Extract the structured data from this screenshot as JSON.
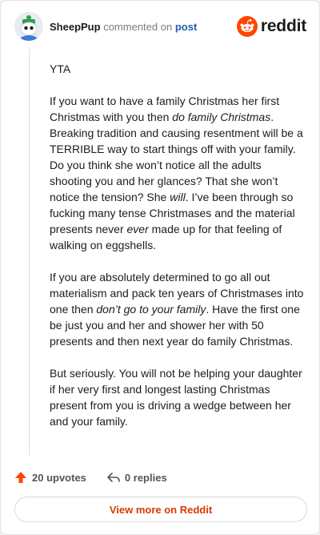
{
  "comment": {
    "username": "SheepPup",
    "commented_on_text": "commented on",
    "post_link_text": "post",
    "body": {
      "p1": "YTA",
      "p2": [
        {
          "t": "If you want to have a family Christmas her first Christmas with you then ",
          "i": false
        },
        {
          "t": "do family Christmas",
          "i": true
        },
        {
          "t": ". Breaking tradition and causing resentment will be a TERRIBLE way to start things off with your family. Do you think she won’t notice all the adults shooting you and her glances? That she won’t notice the tension? She ",
          "i": false
        },
        {
          "t": "will",
          "i": true
        },
        {
          "t": ". I’ve been through so fucking many tense Christmases and the material presents never ",
          "i": false
        },
        {
          "t": "ever",
          "i": true
        },
        {
          "t": " made up for that feeling of walking on eggshells.",
          "i": false
        }
      ],
      "p3": [
        {
          "t": "If you are absolutely determined to go all out materialism and pack ten years of Christmases into one then ",
          "i": false
        },
        {
          "t": "don’t go to your family",
          "i": true
        },
        {
          "t": ". Have the first one be just you and her and shower her with 50 presents and then next year do family Christmas.",
          "i": false
        }
      ],
      "p4": "But seriously. You will not be helping your daughter if her very first and longest lasting Christmas present from you is driving a wedge between her and your family."
    }
  },
  "branding": {
    "logo_text": "reddit",
    "accent_color": "#ff4500"
  },
  "actions": {
    "upvotes_label": "20 upvotes",
    "replies_label": "0 replies"
  },
  "view_more_label": "View more on Reddit",
  "icons": {
    "avatar": "snoo-avatar-icon",
    "logo": "reddit-logo-icon",
    "upvote": "upvote-arrow-icon",
    "reply": "reply-arrow-icon"
  }
}
